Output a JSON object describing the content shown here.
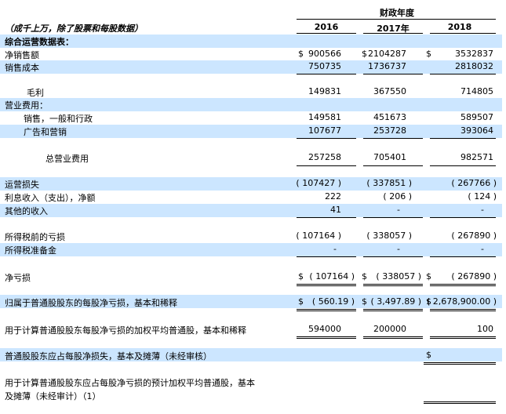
{
  "header": {
    "fiscal_year_title": "财政年度",
    "units_note": "（成千上万，除了股票和每股数据）",
    "columns": [
      "2016",
      "2017年",
      "2018"
    ]
  },
  "section_title": "综合运营数据表：",
  "rows": {
    "net_sales": {
      "label": "净销售额",
      "c1": "900566",
      "c2": "2104287",
      "c3": "3532837"
    },
    "cost_of_sales": {
      "label": "销售成本",
      "c1": "750735",
      "c2": "1736737",
      "c3": "2818032"
    },
    "gross_profit": {
      "label": "毛利",
      "c1": "149831",
      "c2": "367550",
      "c3": "714805"
    },
    "operating_expenses": {
      "label": "营业费用："
    },
    "selling_ga": {
      "label": "销售，一般和行政",
      "c1": "149581",
      "c2": "451673",
      "c3": "589507"
    },
    "advertising": {
      "label": "广告和营销",
      "c1": "107677",
      "c2": "253728",
      "c3": "393064"
    },
    "total_opex": {
      "label": "总营业费用",
      "c1": "257258",
      "c2": "705401",
      "c3": "982571"
    },
    "operating_loss": {
      "label": "运营损失",
      "c1": "( 107427 )",
      "c2": "( 337851 )",
      "c3": "( 267766 )"
    },
    "interest": {
      "label": "利息收入（支出），净额",
      "c1": "222",
      "c2": "( 206 )",
      "c3": "( 124 )"
    },
    "other_income": {
      "label": "其他的收入",
      "c1": "41",
      "c2": "-",
      "c3": "-"
    },
    "pretax_loss": {
      "label": "所得税前的亏损",
      "c1": "( 107164 )",
      "c2": "( 338057 )",
      "c3": "( 267890 )"
    },
    "tax_provision": {
      "label": "所得税准备金",
      "c1": "-",
      "c2": "-",
      "c3": "-"
    },
    "net_loss": {
      "label": "净亏损",
      "c1": "( 107164 )",
      "c2": "( 338057 )",
      "c3": "( 267890 )"
    },
    "eps": {
      "label": "归属于普通股股东的每股净亏损，基本和稀释",
      "c1": "( 560.19 )",
      "c2": "( 3,497.89 )",
      "c3": "( 2,678,900.00 )"
    },
    "weighted_shares": {
      "label": "用于计算普通股股东每股净亏损的加权平均普通股，基本和稀释",
      "c1": "594000",
      "c2": "200000",
      "c3": "100"
    },
    "proforma_eps": {
      "label": "普通股股东应占每股净损失，基本及摊薄（未经审核）"
    },
    "proforma_shares": {
      "label_line1": "用于计算普通股股东应占每股净亏损的预计加权平均普通股，基本",
      "label_line2": "及摊薄（未经审计）（1）"
    }
  },
  "currency_symbol": "$"
}
